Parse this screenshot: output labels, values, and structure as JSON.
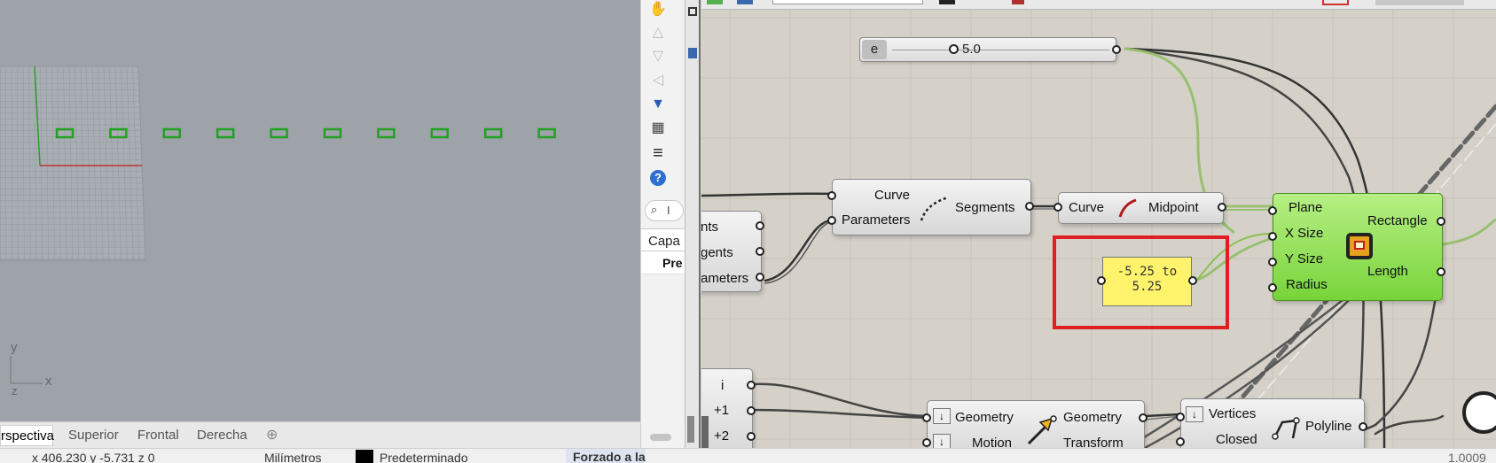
{
  "viewport": {
    "axis_y": "y",
    "axis_x": "x",
    "axis_z": "z",
    "tabs": [
      "rspectiva",
      "Superior",
      "Frontal",
      "Derecha"
    ],
    "add_tab_icon": "plus-icon"
  },
  "statusbar": {
    "coords": "x 406.230  y -5.731  z 0",
    "units": "Milímetros",
    "layer": "Predeterminado",
    "snap": "Forzado a la rejilla",
    "right_value": "1.0009"
  },
  "sidepanel": {
    "search_placeholder": "I",
    "layer_tab": "Capa",
    "layer_column": "Pre"
  },
  "gh": {
    "slider": {
      "label": "e",
      "value": "5.0"
    },
    "divide": {
      "in": [
        "Curve",
        "Parameters"
      ],
      "out": "Segments"
    },
    "midpoint": {
      "in": "Curve",
      "out": "Midpoint"
    },
    "partial_left": [
      "nts",
      "gents",
      "ameters"
    ],
    "panel": {
      "line1": "-5.25 to",
      "line2": "5.25"
    },
    "rectangle": {
      "in": [
        "Plane",
        "X Size",
        "Y Size",
        "Radius"
      ],
      "out": [
        "Rectangle",
        "Length"
      ]
    },
    "list_item": [
      "i",
      "+1",
      "+2"
    ],
    "move": {
      "in": [
        "Geometry",
        "Motion"
      ],
      "out": [
        "Geometry",
        "Transform"
      ]
    },
    "polyline": {
      "in": [
        "Vertices",
        "Closed"
      ],
      "out": "Polyline"
    }
  },
  "colors": {
    "accent_red": "#e02020",
    "panel_yellow": "#fff36b",
    "component_green": "#8fdc4f",
    "rect_green": "#22a022"
  }
}
